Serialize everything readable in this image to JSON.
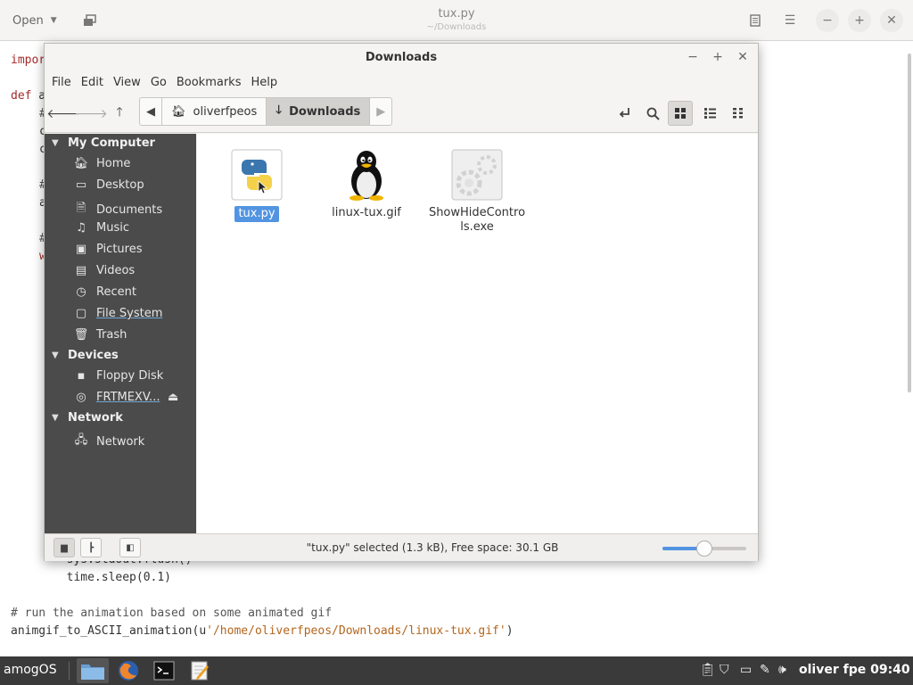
{
  "editor": {
    "open_label": "Open",
    "title": "tux.py",
    "subtitle": "~/Downloads",
    "code_lines": {
      "import_kw": "impor",
      "def_kw": "def",
      "def_rest": " a",
      "flush_line": "        sys.stdout.flush()",
      "sleep_line": "        time.sleep(0.1)",
      "comment_line": "# run the animation based on some animated gif",
      "call_prefix": "animgif_to_ASCII_animation(u",
      "call_string": "'/home/oliverfpeos/Downloads/linux-tux.gif'",
      "call_suffix": ")"
    },
    "partial_lines": [
      "#",
      "c",
      "c",
      "#",
      "a",
      "#",
      "w"
    ]
  },
  "file_manager": {
    "title": "Downloads",
    "menu": [
      "File",
      "Edit",
      "View",
      "Go",
      "Bookmarks",
      "Help"
    ],
    "path": {
      "home": "oliverfpeos",
      "current": "Downloads"
    },
    "sidebar": {
      "my_computer": "My Computer",
      "items": [
        "Home",
        "Desktop",
        "Documents",
        "Music",
        "Pictures",
        "Videos",
        "Recent",
        "File System",
        "Trash"
      ],
      "devices": "Devices",
      "device_items": [
        "Floppy Disk",
        "FRTMEXV..."
      ],
      "network": "Network",
      "network_items": [
        "Network"
      ]
    },
    "files": [
      {
        "name": "tux.py",
        "selected": true
      },
      {
        "name": "linux-tux.gif",
        "selected": false
      },
      {
        "name": "ShowHideControls.exe",
        "selected": false
      }
    ],
    "status": "\"tux.py\" selected (1.3 kB), Free space: 30.1 GB",
    "zoom_level": 0.5
  },
  "taskbar": {
    "menu_label": "amogOS",
    "clock": "oliver fpe 09:40"
  },
  "colors": {
    "accent": "#5294e2",
    "sidebar_bg": "#4b4b4b",
    "taskbar_bg": "#3a3a3a"
  }
}
